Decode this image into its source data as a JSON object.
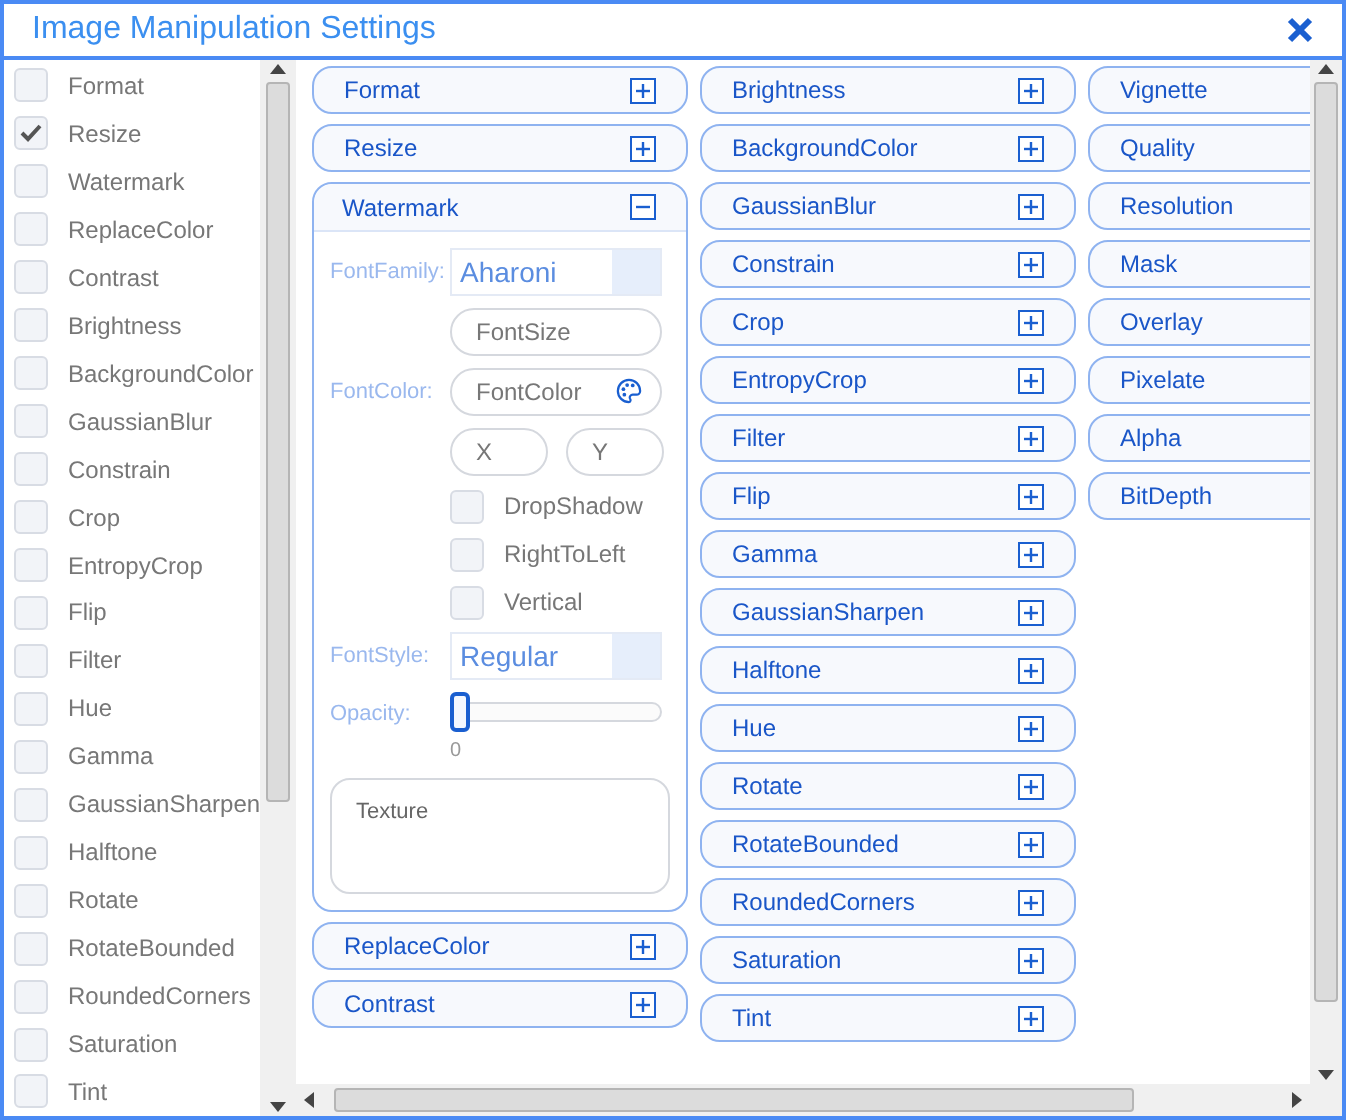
{
  "window": {
    "title": "Image Manipulation Settings"
  },
  "processors": [
    {
      "label": "Format",
      "checked": false
    },
    {
      "label": "Resize",
      "checked": true
    },
    {
      "label": "Watermark",
      "checked": false
    },
    {
      "label": "ReplaceColor",
      "checked": false
    },
    {
      "label": "Contrast",
      "checked": false
    },
    {
      "label": "Brightness",
      "checked": false
    },
    {
      "label": "BackgroundColor",
      "checked": false
    },
    {
      "label": "GaussianBlur",
      "checked": false
    },
    {
      "label": "Constrain",
      "checked": false
    },
    {
      "label": "Crop",
      "checked": false
    },
    {
      "label": "EntropyCrop",
      "checked": false
    },
    {
      "label": "Flip",
      "checked": false
    },
    {
      "label": "Filter",
      "checked": false
    },
    {
      "label": "Hue",
      "checked": false
    },
    {
      "label": "Gamma",
      "checked": false
    },
    {
      "label": "GaussianSharpen",
      "checked": false
    },
    {
      "label": "Halftone",
      "checked": false
    },
    {
      "label": "Rotate",
      "checked": false
    },
    {
      "label": "RotateBounded",
      "checked": false
    },
    {
      "label": "RoundedCorners",
      "checked": false
    },
    {
      "label": "Saturation",
      "checked": false
    },
    {
      "label": "Tint",
      "checked": false
    }
  ],
  "columns": [
    [
      {
        "title": "Format",
        "expanded": false
      },
      {
        "title": "Resize",
        "expanded": false
      },
      {
        "title": "Watermark",
        "expanded": true,
        "form": {
          "font_family_label": "FontFamily:",
          "font_family": "Aharoni",
          "font_size_placeholder": "FontSize",
          "font_color_label": "FontColor:",
          "font_color_placeholder": "FontColor",
          "x_placeholder": "X",
          "y_placeholder": "Y",
          "options": [
            {
              "label": "DropShadow",
              "checked": false
            },
            {
              "label": "RightToLeft",
              "checked": false
            },
            {
              "label": "Vertical",
              "checked": false
            }
          ],
          "font_style_label": "FontStyle:",
          "font_style": "Regular",
          "opacity": {
            "label": "Opacity:",
            "level": 0,
            "reading": "0"
          },
          "texture_placeholder": "Texture"
        }
      },
      {
        "title": "ReplaceColor",
        "expanded": false
      },
      {
        "title": "Contrast",
        "expanded": false
      }
    ],
    [
      {
        "title": "Brightness",
        "expanded": false
      },
      {
        "title": "BackgroundColor",
        "expanded": false
      },
      {
        "title": "GaussianBlur",
        "expanded": false
      },
      {
        "title": "Constrain",
        "expanded": false
      },
      {
        "title": "Crop",
        "expanded": false
      },
      {
        "title": "EntropyCrop",
        "expanded": false
      },
      {
        "title": "Filter",
        "expanded": false
      },
      {
        "title": "Flip",
        "expanded": false
      },
      {
        "title": "Gamma",
        "expanded": false
      },
      {
        "title": "GaussianSharpen",
        "expanded": false
      },
      {
        "title": "Halftone",
        "expanded": false
      },
      {
        "title": "Hue",
        "expanded": false
      },
      {
        "title": "Rotate",
        "expanded": false
      },
      {
        "title": "RotateBounded",
        "expanded": false
      },
      {
        "title": "RoundedCorners",
        "expanded": false
      },
      {
        "title": "Saturation",
        "expanded": false
      },
      {
        "title": "Tint",
        "expanded": false
      }
    ],
    [
      {
        "title": "Vignette"
      },
      {
        "title": "Quality"
      },
      {
        "title": "Resolution"
      },
      {
        "title": "Mask"
      },
      {
        "title": "Overlay"
      },
      {
        "title": "Pixelate"
      },
      {
        "title": "Alpha"
      },
      {
        "title": "BitDepth"
      }
    ]
  ]
}
